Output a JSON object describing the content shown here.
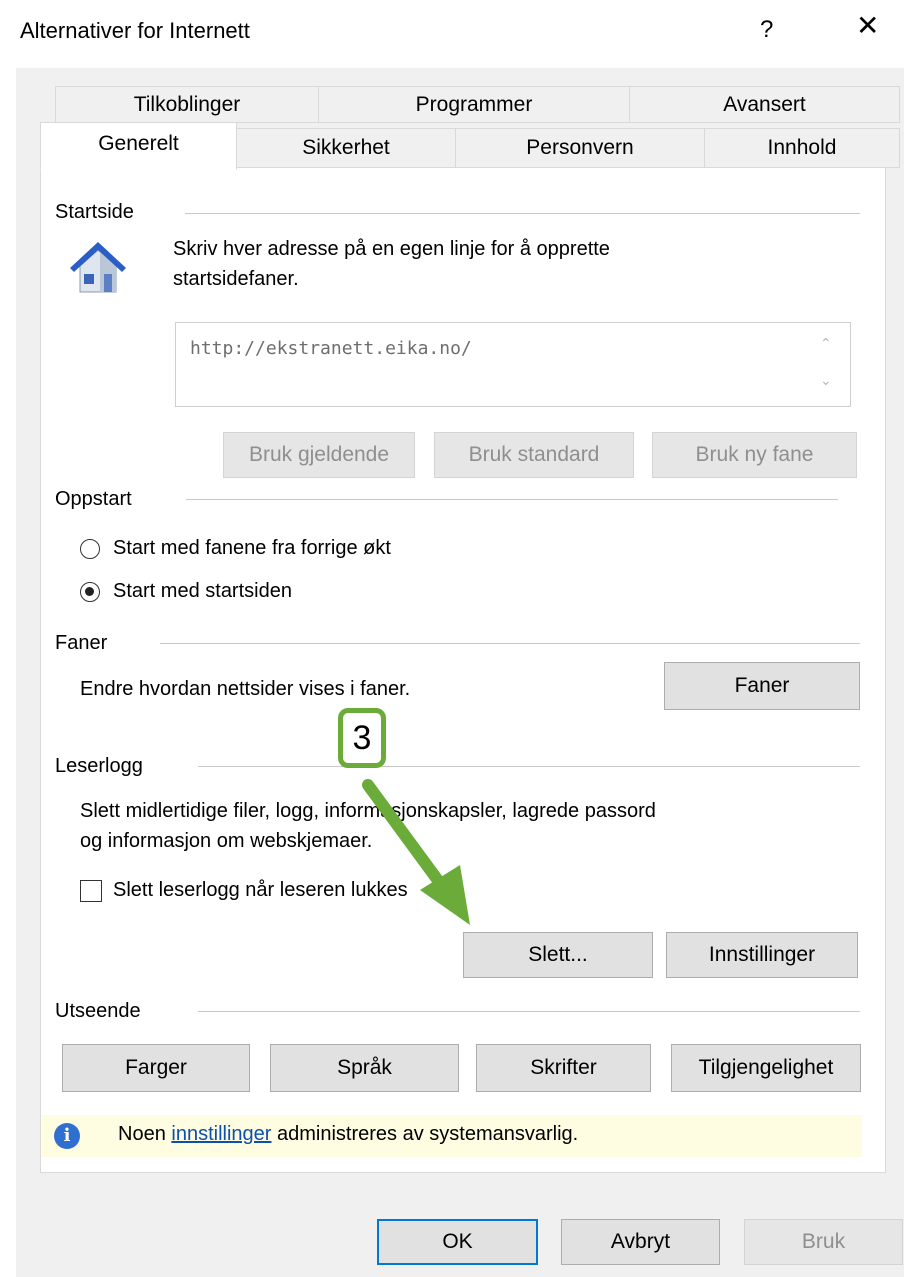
{
  "window": {
    "title": "Alternativer for Internett",
    "help_glyph": "?",
    "close_glyph": "✕"
  },
  "tabs": {
    "row1": [
      "Tilkoblinger",
      "Programmer",
      "Avansert"
    ],
    "row2": [
      "Generelt",
      "Sikkerhet",
      "Personvern",
      "Innhold"
    ],
    "active": "Generelt"
  },
  "startside": {
    "label": "Startside",
    "description_line1": "Skriv hver adresse på en egen linje for å opprette",
    "description_line2": "startsidefaner.",
    "url_value": "http://ekstranett.eika.no/",
    "buttons": {
      "current": "Bruk gjeldende",
      "default": "Bruk standard",
      "new_tab": "Bruk ny fane"
    }
  },
  "oppstart": {
    "label": "Oppstart",
    "option_previous": "Start med fanene fra forrige økt",
    "option_homepage": "Start med startsiden",
    "selected": "option_homepage"
  },
  "faner": {
    "label": "Faner",
    "description": "Endre hvordan nettsider vises i faner.",
    "button": "Faner"
  },
  "leserlogg": {
    "label": "Leserlogg",
    "description_line1": "Slett midlertidige filer, logg, informasjonskapsler, lagrede passord",
    "description_line2": "og informasjon om webskjemaer.",
    "checkbox_label": "Slett leserlogg når leseren lukkes",
    "checkbox_checked": false,
    "delete_button": "Slett...",
    "settings_button": "Innstillinger"
  },
  "utseende": {
    "label": "Utseende",
    "buttons": [
      "Farger",
      "Språk",
      "Skrifter",
      "Tilgjengelighet"
    ]
  },
  "notice": {
    "before": "Noen ",
    "link": "innstillinger",
    "after": " administreres av systemansvarlig."
  },
  "annotation": {
    "step_number": "3",
    "color": "#6aab3a"
  },
  "footer": {
    "ok": "OK",
    "cancel": "Avbryt",
    "apply": "Bruk"
  },
  "colors": {
    "accent": "#0078d7",
    "notice_bg": "#fffde1",
    "link": "#0b4fb0"
  }
}
